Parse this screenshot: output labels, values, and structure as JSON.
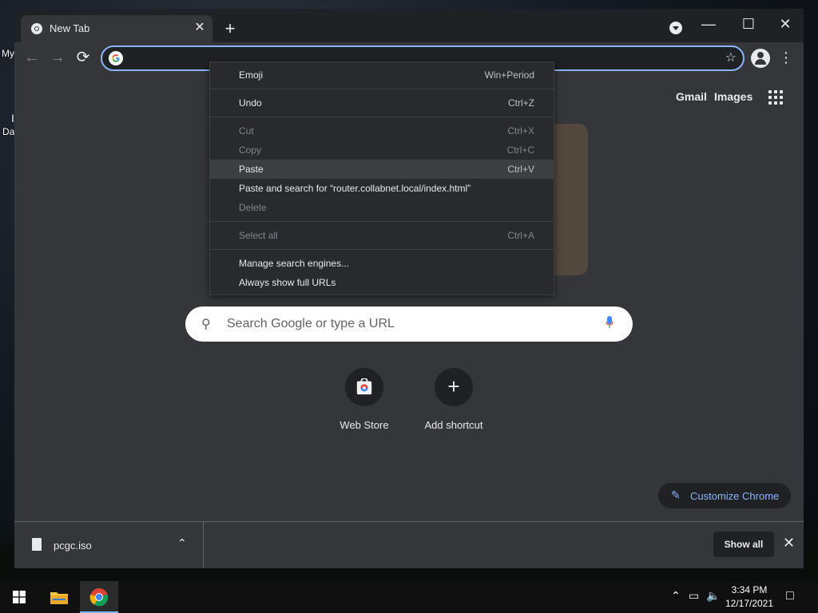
{
  "desktop": {
    "label_my": "My",
    "label_da": "Da",
    "label_i": "I"
  },
  "browser": {
    "tab": {
      "title": "New Tab"
    },
    "new_tab_symbol": "+",
    "window_controls": {
      "minimize": "—",
      "maximize": "☐",
      "close": "✕"
    },
    "toolbar": {
      "back_symbol": "←",
      "forward_symbol": "→",
      "reload_symbol": "⟳",
      "omnibox_value": "",
      "star_symbol": "☆",
      "menu_symbol": "⋮"
    }
  },
  "ntp": {
    "gmail": "Gmail",
    "images": "Images",
    "search_placeholder": "Search Google or type a URL",
    "shortcuts": [
      {
        "label": "Web Store"
      },
      {
        "label": "Add shortcut"
      }
    ],
    "customize_label": "Customize Chrome"
  },
  "context_menu": {
    "items": [
      {
        "label": "Emoji",
        "shortcut": "Win+Period",
        "enabled": true
      },
      {
        "label": "Undo",
        "shortcut": "Ctrl+Z",
        "enabled": true
      },
      {
        "label": "Cut",
        "shortcut": "Ctrl+X",
        "enabled": false
      },
      {
        "label": "Copy",
        "shortcut": "Ctrl+C",
        "enabled": false
      },
      {
        "label": "Paste",
        "shortcut": "Ctrl+V",
        "enabled": true
      },
      {
        "label": "Paste and search for “router.collabnet.local/index.html”",
        "shortcut": "",
        "enabled": true
      },
      {
        "label": "Delete",
        "shortcut": "",
        "enabled": false
      },
      {
        "label": "Select all",
        "shortcut": "Ctrl+A",
        "enabled": false
      },
      {
        "label": "Manage search engines...",
        "shortcut": "",
        "enabled": true
      },
      {
        "label": "Always show full URLs",
        "shortcut": "",
        "enabled": true
      }
    ]
  },
  "download_shelf": {
    "file_name": "pcgc.iso",
    "show_all": "Show all"
  },
  "taskbar": {
    "time": "3:34 PM",
    "date": "12/17/2021"
  },
  "colors": {
    "accent": "#8ab4f8",
    "toolbar_bg": "#35363a",
    "frame_bg": "#202124",
    "menu_bg": "#292a2d"
  }
}
